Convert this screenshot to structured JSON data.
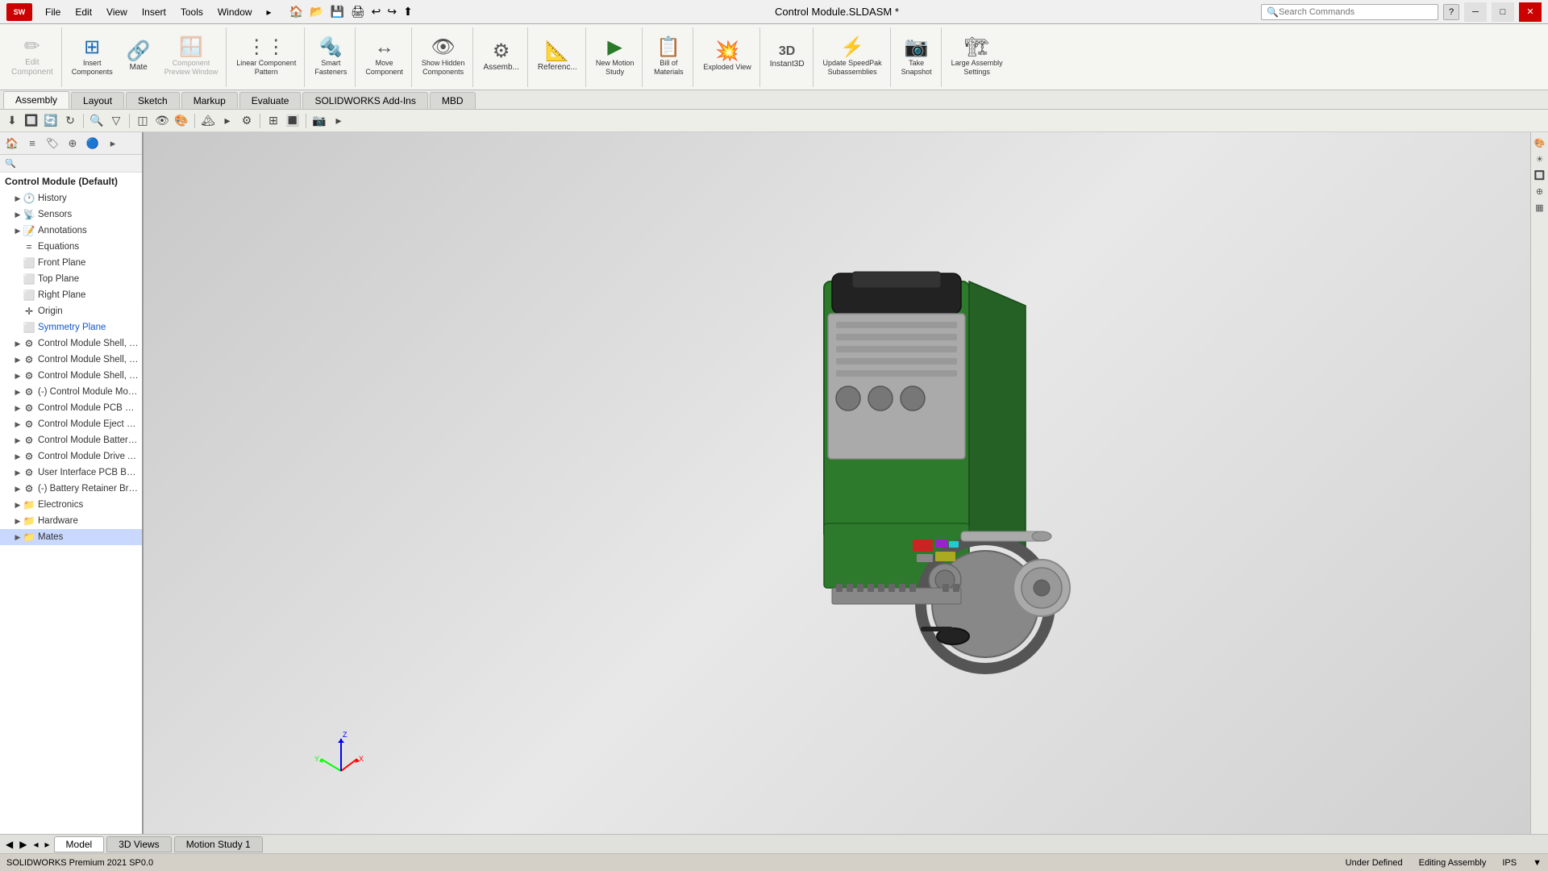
{
  "app": {
    "logo": "SW",
    "title": "Control Module.SLDASM *",
    "version": "SOLIDWORKS Premium 2021 SP0.0"
  },
  "titlebar": {
    "menus": [
      "File",
      "Edit",
      "View",
      "Insert",
      "Tools",
      "Window"
    ],
    "search_placeholder": "Search Commands",
    "window_buttons": [
      "─",
      "□",
      "✕"
    ]
  },
  "toolbar": {
    "groups": [
      {
        "buttons": [
          {
            "id": "edit-component",
            "icon": "✏️",
            "label": "Edit\nComponent",
            "disabled": false
          },
          {
            "id": "insert-components",
            "icon": "⊞",
            "label": "Insert\nComponents",
            "disabled": false
          },
          {
            "id": "mate",
            "icon": "🔗",
            "label": "Mate",
            "disabled": false
          },
          {
            "id": "component-preview",
            "icon": "👁",
            "label": "Component\nPreview Window",
            "disabled": true
          }
        ]
      },
      {
        "buttons": [
          {
            "id": "linear-pattern",
            "icon": "⋮⋮",
            "label": "Linear Component\nPattern",
            "disabled": false
          }
        ]
      },
      {
        "buttons": [
          {
            "id": "smart-fasteners",
            "icon": "🔩",
            "label": "Smart\nFasteners",
            "disabled": false
          }
        ]
      },
      {
        "buttons": [
          {
            "id": "move-component",
            "icon": "↔",
            "label": "Move\nComponent",
            "disabled": false
          }
        ]
      },
      {
        "buttons": [
          {
            "id": "show-hidden",
            "icon": "👁",
            "label": "Show Hidden\nComponents",
            "disabled": false
          }
        ]
      },
      {
        "buttons": [
          {
            "id": "assembly-features",
            "icon": "⚙",
            "label": "Assemb...",
            "disabled": false
          }
        ]
      },
      {
        "buttons": [
          {
            "id": "reference-geometry",
            "icon": "📐",
            "label": "Referenc...",
            "disabled": false
          }
        ]
      },
      {
        "buttons": [
          {
            "id": "new-motion-study",
            "icon": "▶",
            "label": "New Motion\nStudy",
            "disabled": false
          }
        ]
      },
      {
        "buttons": [
          {
            "id": "bill-of-materials",
            "icon": "📋",
            "label": "Bill of\nMaterials",
            "disabled": false
          }
        ]
      },
      {
        "buttons": [
          {
            "id": "exploded-view",
            "icon": "💥",
            "label": "Exploded View",
            "disabled": false
          }
        ]
      },
      {
        "buttons": [
          {
            "id": "instant3d",
            "icon": "3D",
            "label": "Instant3D",
            "disabled": false
          }
        ]
      },
      {
        "buttons": [
          {
            "id": "update-speedpak",
            "icon": "⚡",
            "label": "Update SpeedPak\nSubassemblies",
            "disabled": false
          }
        ]
      },
      {
        "buttons": [
          {
            "id": "take-snapshot",
            "icon": "📷",
            "label": "Take\nSnapshot",
            "disabled": false
          }
        ]
      },
      {
        "buttons": [
          {
            "id": "large-assembly",
            "icon": "🏗",
            "label": "Large Assembly\nSettings",
            "disabled": false
          }
        ]
      }
    ]
  },
  "tabs": [
    "Assembly",
    "Layout",
    "Sketch",
    "Markup",
    "Evaluate",
    "SOLIDWORKS Add-Ins",
    "MBD"
  ],
  "active_tab": "Assembly",
  "featuretree": {
    "root": "Control Module  (Default)",
    "items": [
      {
        "id": "history",
        "icon": "🕐",
        "label": "History",
        "indent": 1,
        "hasArrow": true,
        "arrow": "▶"
      },
      {
        "id": "sensors",
        "icon": "📡",
        "label": "Sensors",
        "indent": 1,
        "hasArrow": true,
        "arrow": "▶"
      },
      {
        "id": "annotations",
        "icon": "📝",
        "label": "Annotations",
        "indent": 1,
        "hasArrow": true,
        "arrow": "▶"
      },
      {
        "id": "equations",
        "icon": "=",
        "label": "Equations",
        "indent": 1,
        "hasArrow": false
      },
      {
        "id": "front-plane",
        "icon": "⬜",
        "label": "Front Plane",
        "indent": 1,
        "hasArrow": false
      },
      {
        "id": "top-plane",
        "icon": "⬜",
        "label": "Top Plane",
        "indent": 1,
        "hasArrow": false
      },
      {
        "id": "right-plane",
        "icon": "⬜",
        "label": "Right Plane",
        "indent": 1,
        "hasArrow": false
      },
      {
        "id": "origin",
        "icon": "✛",
        "label": "Origin",
        "indent": 1,
        "hasArrow": false
      },
      {
        "id": "symmetry-plane",
        "icon": "⬜",
        "label": "Symmetry Plane",
        "indent": 1,
        "hasArrow": false,
        "blue": true
      },
      {
        "id": "shell-bott",
        "icon": "⚙",
        "label": "Control Module Shell, Bott...",
        "indent": 1,
        "hasArrow": true,
        "arrow": "▶"
      },
      {
        "id": "shell-top",
        "icon": "⚙",
        "label": "Control Module Shell, Top-...",
        "indent": 1,
        "hasArrow": true,
        "arrow": "▶"
      },
      {
        "id": "shell-wire",
        "icon": "⚙",
        "label": "Control Module Shell, Wire...",
        "indent": 1,
        "hasArrow": true,
        "arrow": "▶"
      },
      {
        "id": "motor",
        "icon": "⚙",
        "label": "(-) Control Module Motor H...",
        "indent": 1,
        "hasArrow": true,
        "arrow": "▶"
      },
      {
        "id": "pcb-cover",
        "icon": "⚙",
        "label": "Control Module PCB Cover...",
        "indent": 1,
        "hasArrow": true,
        "arrow": "▶"
      },
      {
        "id": "eject-butt",
        "icon": "⚙",
        "label": "Control Module Eject Butto...",
        "indent": 1,
        "hasArrow": true,
        "arrow": "▶"
      },
      {
        "id": "battery-door",
        "icon": "⚙",
        "label": "Control Module Battery Do...",
        "indent": 1,
        "hasArrow": true,
        "arrow": "▶"
      },
      {
        "id": "drive-asse",
        "icon": "⚙",
        "label": "Control Module Drive Asse...",
        "indent": 1,
        "hasArrow": true,
        "arrow": "▶"
      },
      {
        "id": "ui-pcb",
        "icon": "⚙",
        "label": "User Interface PCB Board A...",
        "indent": 1,
        "hasArrow": true,
        "arrow": "▶"
      },
      {
        "id": "battery-bracket",
        "icon": "⚙",
        "label": "(-) Battery Retainer Bracket...",
        "indent": 1,
        "hasArrow": true,
        "arrow": "▶"
      },
      {
        "id": "electronics",
        "icon": "📁",
        "label": "Electronics",
        "indent": 1,
        "hasArrow": true,
        "arrow": "▶"
      },
      {
        "id": "hardware",
        "icon": "📁",
        "label": "Hardware",
        "indent": 1,
        "hasArrow": true,
        "arrow": "▶"
      },
      {
        "id": "mates",
        "icon": "📁",
        "label": "Mates",
        "indent": 1,
        "hasArrow": true,
        "arrow": "▶",
        "selected": true
      }
    ]
  },
  "bottom_tabs": [
    "Model",
    "3D Views",
    "Motion Study 1"
  ],
  "active_bottom_tab": "Model",
  "statusbar": {
    "left": "SOLIDWORKS Premium 2021 SP0.0",
    "status": "Under Defined",
    "editing": "Editing Assembly",
    "units": "IPS"
  }
}
